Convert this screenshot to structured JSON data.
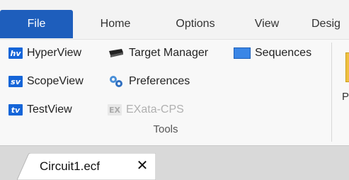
{
  "tabs": [
    {
      "label": "File",
      "active": true
    },
    {
      "label": "Home",
      "active": false
    },
    {
      "label": "Options",
      "active": false
    },
    {
      "label": "View",
      "active": false
    },
    {
      "label": "Desig",
      "active": false
    }
  ],
  "tools_group": {
    "label": "Tools",
    "items": [
      {
        "label": "HyperView",
        "icon": "hyperview-icon",
        "badge": "hv",
        "enabled": true
      },
      {
        "label": "ScopeView",
        "icon": "scopeview-icon",
        "badge": "sv",
        "enabled": true
      },
      {
        "label": "TestView",
        "icon": "testview-icon",
        "badge": "tv",
        "enabled": true
      },
      {
        "label": "Target Manager",
        "icon": "target-manager-icon",
        "enabled": true
      },
      {
        "label": "Preferences",
        "icon": "preferences-gear-icon",
        "enabled": true
      },
      {
        "label": "EXata-CPS",
        "icon": "exata-cps-icon",
        "badge": "EX",
        "enabled": false
      },
      {
        "label": "Sequences",
        "icon": "sequences-icon",
        "enabled": true
      }
    ]
  },
  "next_group": {
    "partial_label": "P"
  },
  "document_tabs": [
    {
      "label": "Circuit1.ecf",
      "close": "✕"
    }
  ],
  "colors": {
    "accent": "#1e5ebc",
    "icon_blue": "#1565d8"
  }
}
